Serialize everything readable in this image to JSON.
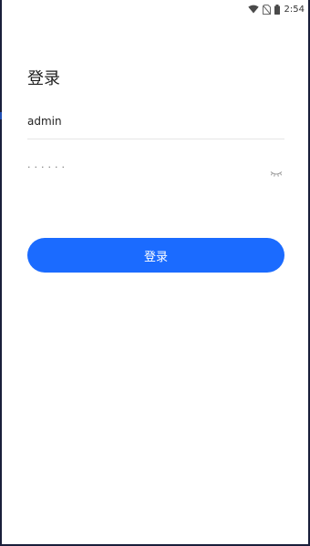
{
  "status_bar": {
    "time": "2:54",
    "icons": [
      "wifi-icon",
      "no-sim-icon",
      "battery-icon"
    ]
  },
  "login": {
    "title": "登录",
    "username_value": "admin",
    "password_masked": "······",
    "password_toggle_icon": "eye-closed-icon",
    "submit_label": "登录"
  },
  "colors": {
    "accent": "#1b6bff",
    "frame": "#1a1f3a"
  }
}
